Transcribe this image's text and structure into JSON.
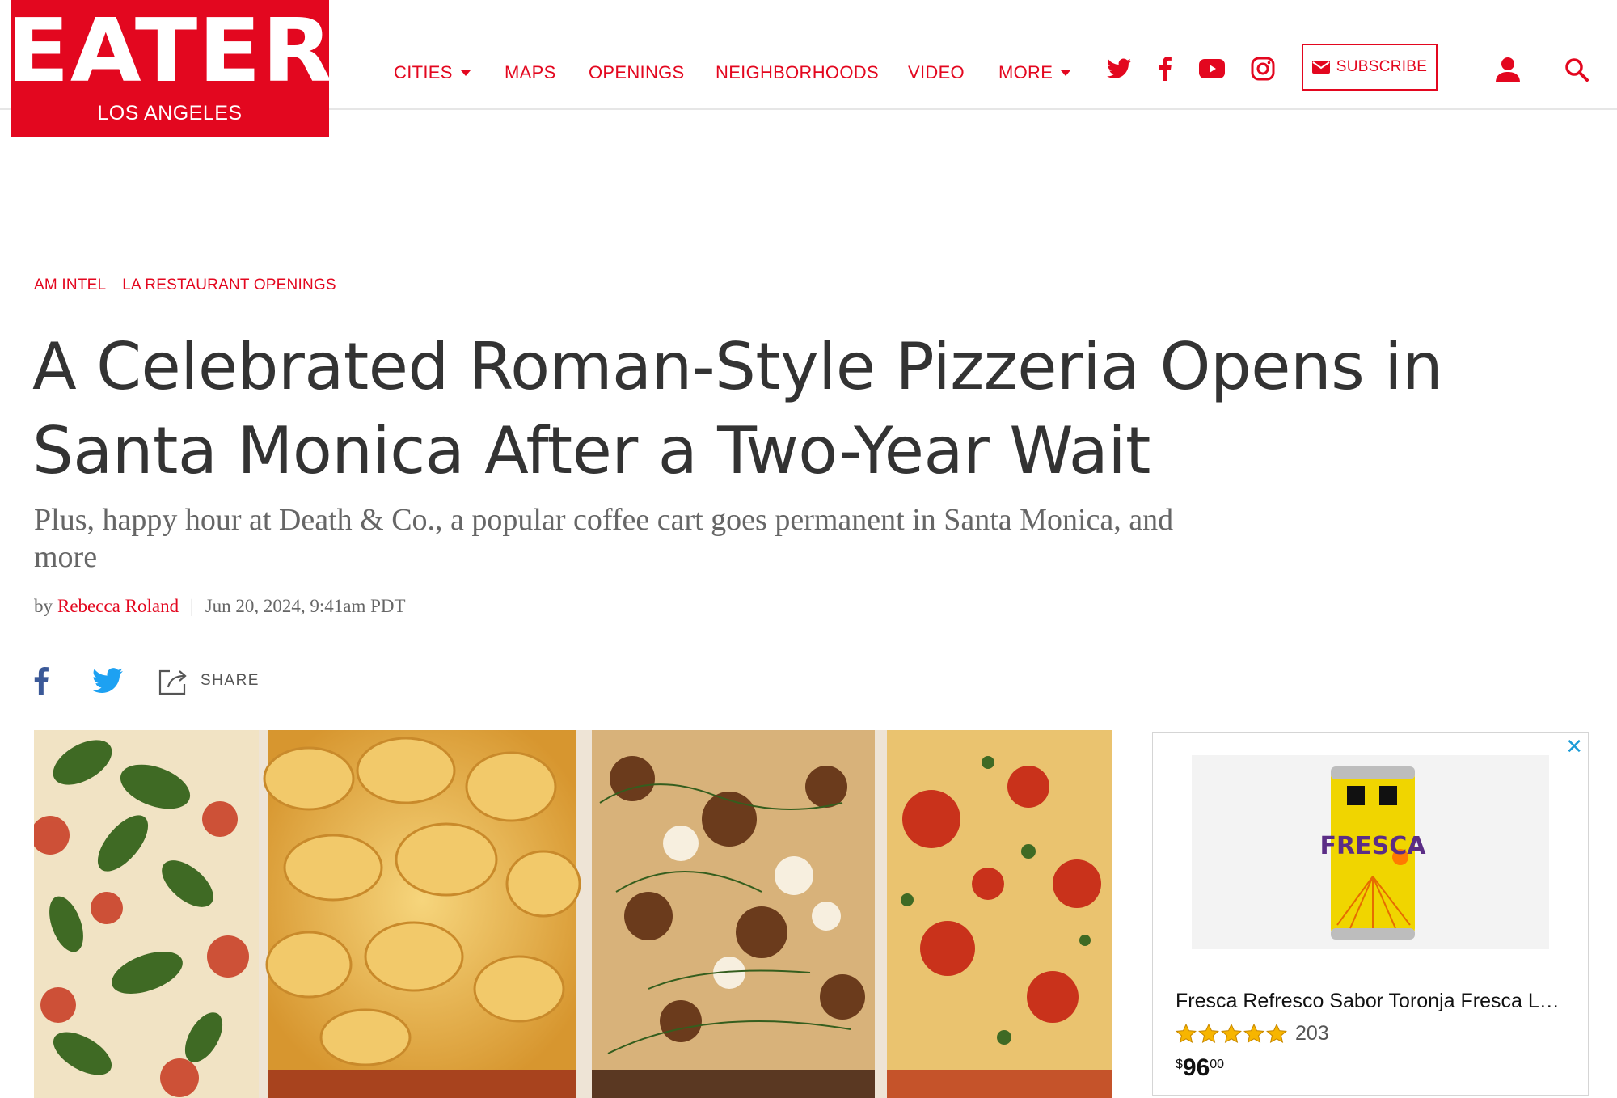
{
  "brand": {
    "name": "EATER",
    "city": "LOS ANGELES",
    "color": "#e3071f"
  },
  "nav": {
    "items": [
      {
        "label": "CITIES",
        "has_caret": true
      },
      {
        "label": "MAPS",
        "has_caret": false
      },
      {
        "label": "OPENINGS",
        "has_caret": false
      },
      {
        "label": "NEIGHBORHOODS",
        "has_caret": false
      },
      {
        "label": "VIDEO",
        "has_caret": false
      },
      {
        "label": "MORE",
        "has_caret": true
      }
    ],
    "social_icons": [
      "twitter-icon",
      "facebook-icon",
      "youtube-icon",
      "instagram-icon"
    ],
    "subscribe_label": "SUBSCRIBE",
    "account_icon": "user-icon",
    "search_icon": "search-icon"
  },
  "article": {
    "tags": [
      "AM INTEL",
      "LA RESTAURANT OPENINGS"
    ],
    "headline": "A Celebrated Roman-Style Pizzeria Opens in Santa Monica After a Two-Year Wait",
    "dek": "Plus, happy hour at Death & Co., a popular coffee cart goes permanent in Santa Monica, and more",
    "byline_prefix": "by",
    "author": "Rebecca Roland",
    "separator": "|",
    "date": "Jun 20, 2024, 9:41am PDT",
    "share_label": "SHARE",
    "share_icons": [
      "facebook-icon",
      "twitter-icon",
      "share-icon"
    ]
  },
  "ad": {
    "title": "Fresca Refresco Sabor Toronja Fresca La...",
    "rating_stars": 5,
    "rating_count": "203",
    "price_currency": "$",
    "price_whole": "96",
    "price_fraction": "00",
    "can_label": "FRESCA",
    "close_icon": "close-icon"
  }
}
